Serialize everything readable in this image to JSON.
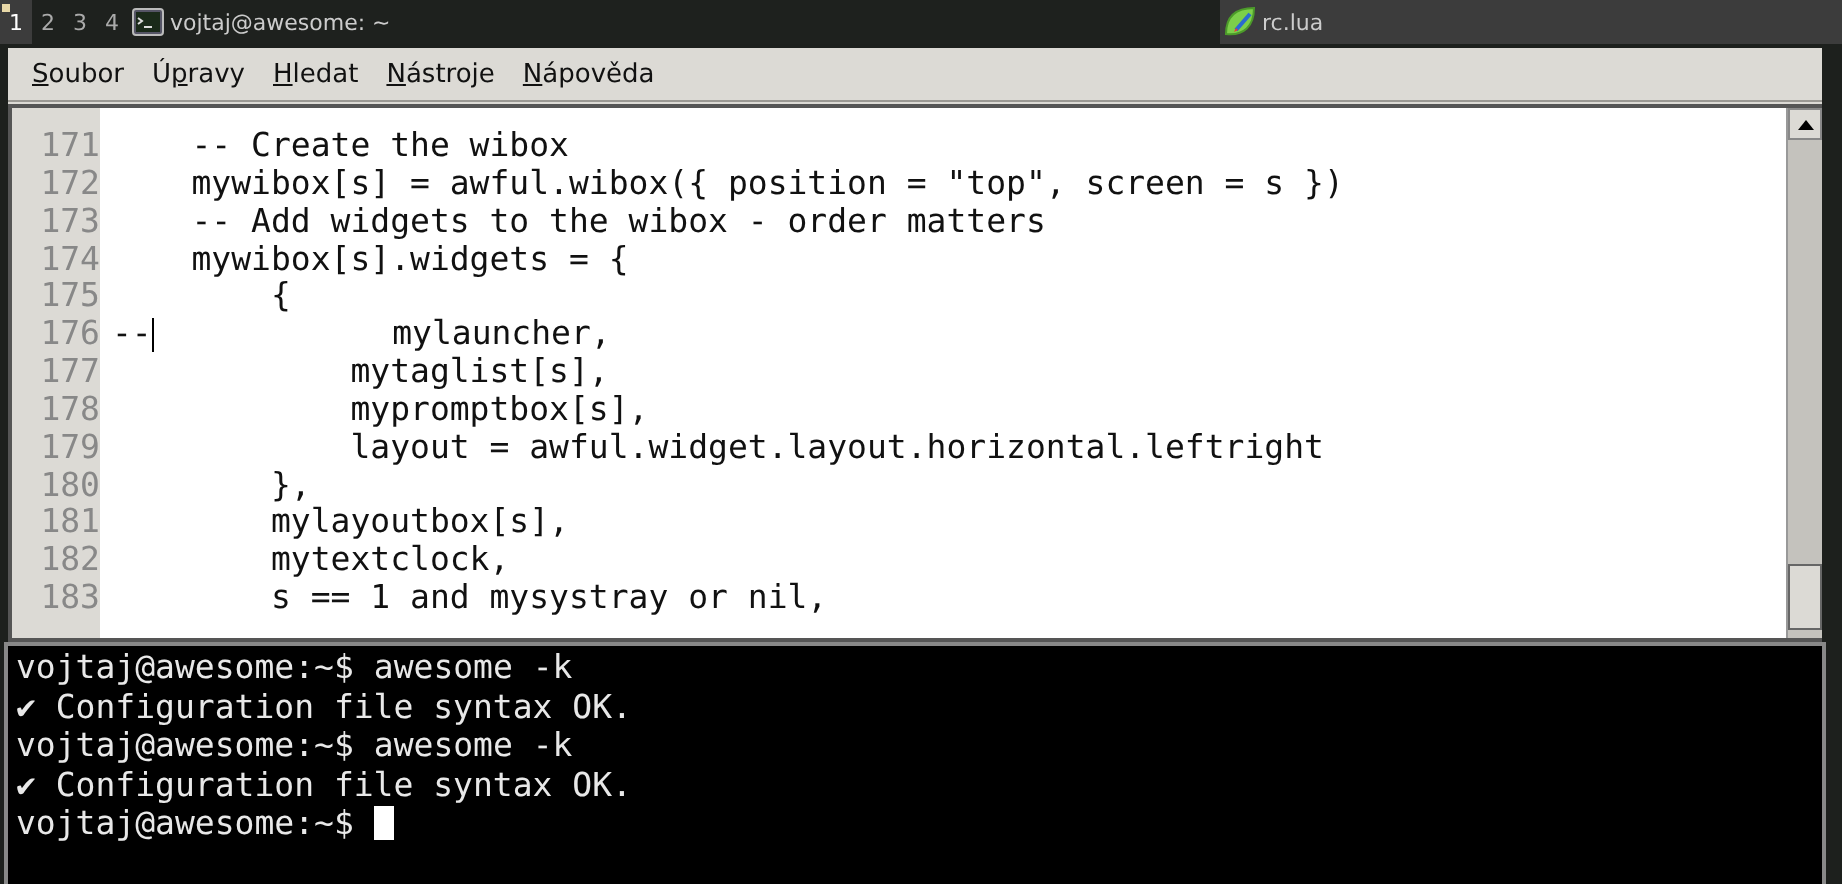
{
  "panel": {
    "tags": [
      {
        "label": "1",
        "selected": true
      },
      {
        "label": "2",
        "selected": false
      },
      {
        "label": "3",
        "selected": false
      },
      {
        "label": "4",
        "selected": false
      }
    ],
    "tasks": [
      {
        "title": "vojtaj@awesome: ~",
        "kind": "terminal",
        "focused": false
      },
      {
        "title": "rc.lua",
        "kind": "editor",
        "focused": true
      }
    ]
  },
  "menu": [
    {
      "key": "S",
      "after": "oubor"
    },
    {
      "before": "Ú",
      "key": "p",
      "after": "ravy"
    },
    {
      "key": "H",
      "after": "ledat"
    },
    {
      "key": "N",
      "after": "ástroje"
    },
    {
      "key": "N",
      "after": "ápověda"
    }
  ],
  "editor": {
    "lines": [
      {
        "number": "171",
        "text": "    -- Create the wibox"
      },
      {
        "number": "172",
        "text": "    mywibox[s] = awful.wibox({ position = \"top\", screen = s })"
      },
      {
        "number": "173",
        "text": "    -- Add widgets to the wibox - order matters"
      },
      {
        "number": "174",
        "text": "    mywibox[s].widgets = {"
      },
      {
        "number": "175",
        "text": "        {"
      },
      {
        "number": "176",
        "pre": "--",
        "text": "            mylauncher,"
      },
      {
        "number": "177",
        "text": "            mytaglist[s],"
      },
      {
        "number": "178",
        "text": "            mypromptbox[s],"
      },
      {
        "number": "179",
        "text": "            layout = awful.widget.layout.horizontal.leftright"
      },
      {
        "number": "180",
        "text": "        },"
      },
      {
        "number": "181",
        "text": "        mylayoutbox[s],"
      },
      {
        "number": "182",
        "text": "        mytextclock,"
      },
      {
        "number": "183",
        "text": "        s == 1 and mysystray or nil,"
      }
    ]
  },
  "terminal": {
    "lines": [
      {
        "kind": "prompt",
        "prompt": "vojtaj@awesome:~$",
        "command": "awesome -k",
        "cursor": false
      },
      {
        "kind": "output",
        "text": "✔ Configuration file syntax OK."
      },
      {
        "kind": "prompt",
        "prompt": "vojtaj@awesome:~$",
        "command": "awesome -k",
        "cursor": false
      },
      {
        "kind": "output",
        "text": "✔ Configuration file syntax OK."
      },
      {
        "kind": "prompt",
        "prompt": "vojtaj@awesome:~$",
        "cursor": true
      }
    ]
  }
}
